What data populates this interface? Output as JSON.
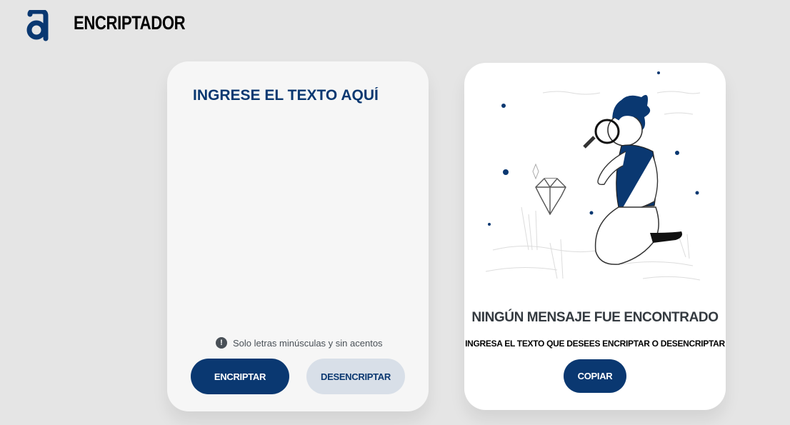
{
  "header": {
    "logo_icon": "alura-logo-icon",
    "title": "ENCRIPTADOR"
  },
  "input_panel": {
    "placeholder": "INGRESE EL TEXTO AQUÍ",
    "value": "",
    "hint_icon": "exclamation-circle-icon",
    "hint": "Solo letras minúsculas y sin acentos",
    "encrypt_label": "ENCRIPTAR",
    "decrypt_label": "DESENCRIPTAR"
  },
  "output_panel": {
    "illustration": "person-with-magnifying-glass-illustration",
    "title": "NINGÚN MENSAJE FUE ENCONTRADO",
    "subtitle": "INGRESA EL TEXTO QUE DESEES ENCRIPTAR O DESENCRIPTAR",
    "copy_label": "COPIAR"
  },
  "colors": {
    "background": "#e5e5e5",
    "primary": "#0a3871",
    "secondary_button": "#d8dfe8"
  }
}
